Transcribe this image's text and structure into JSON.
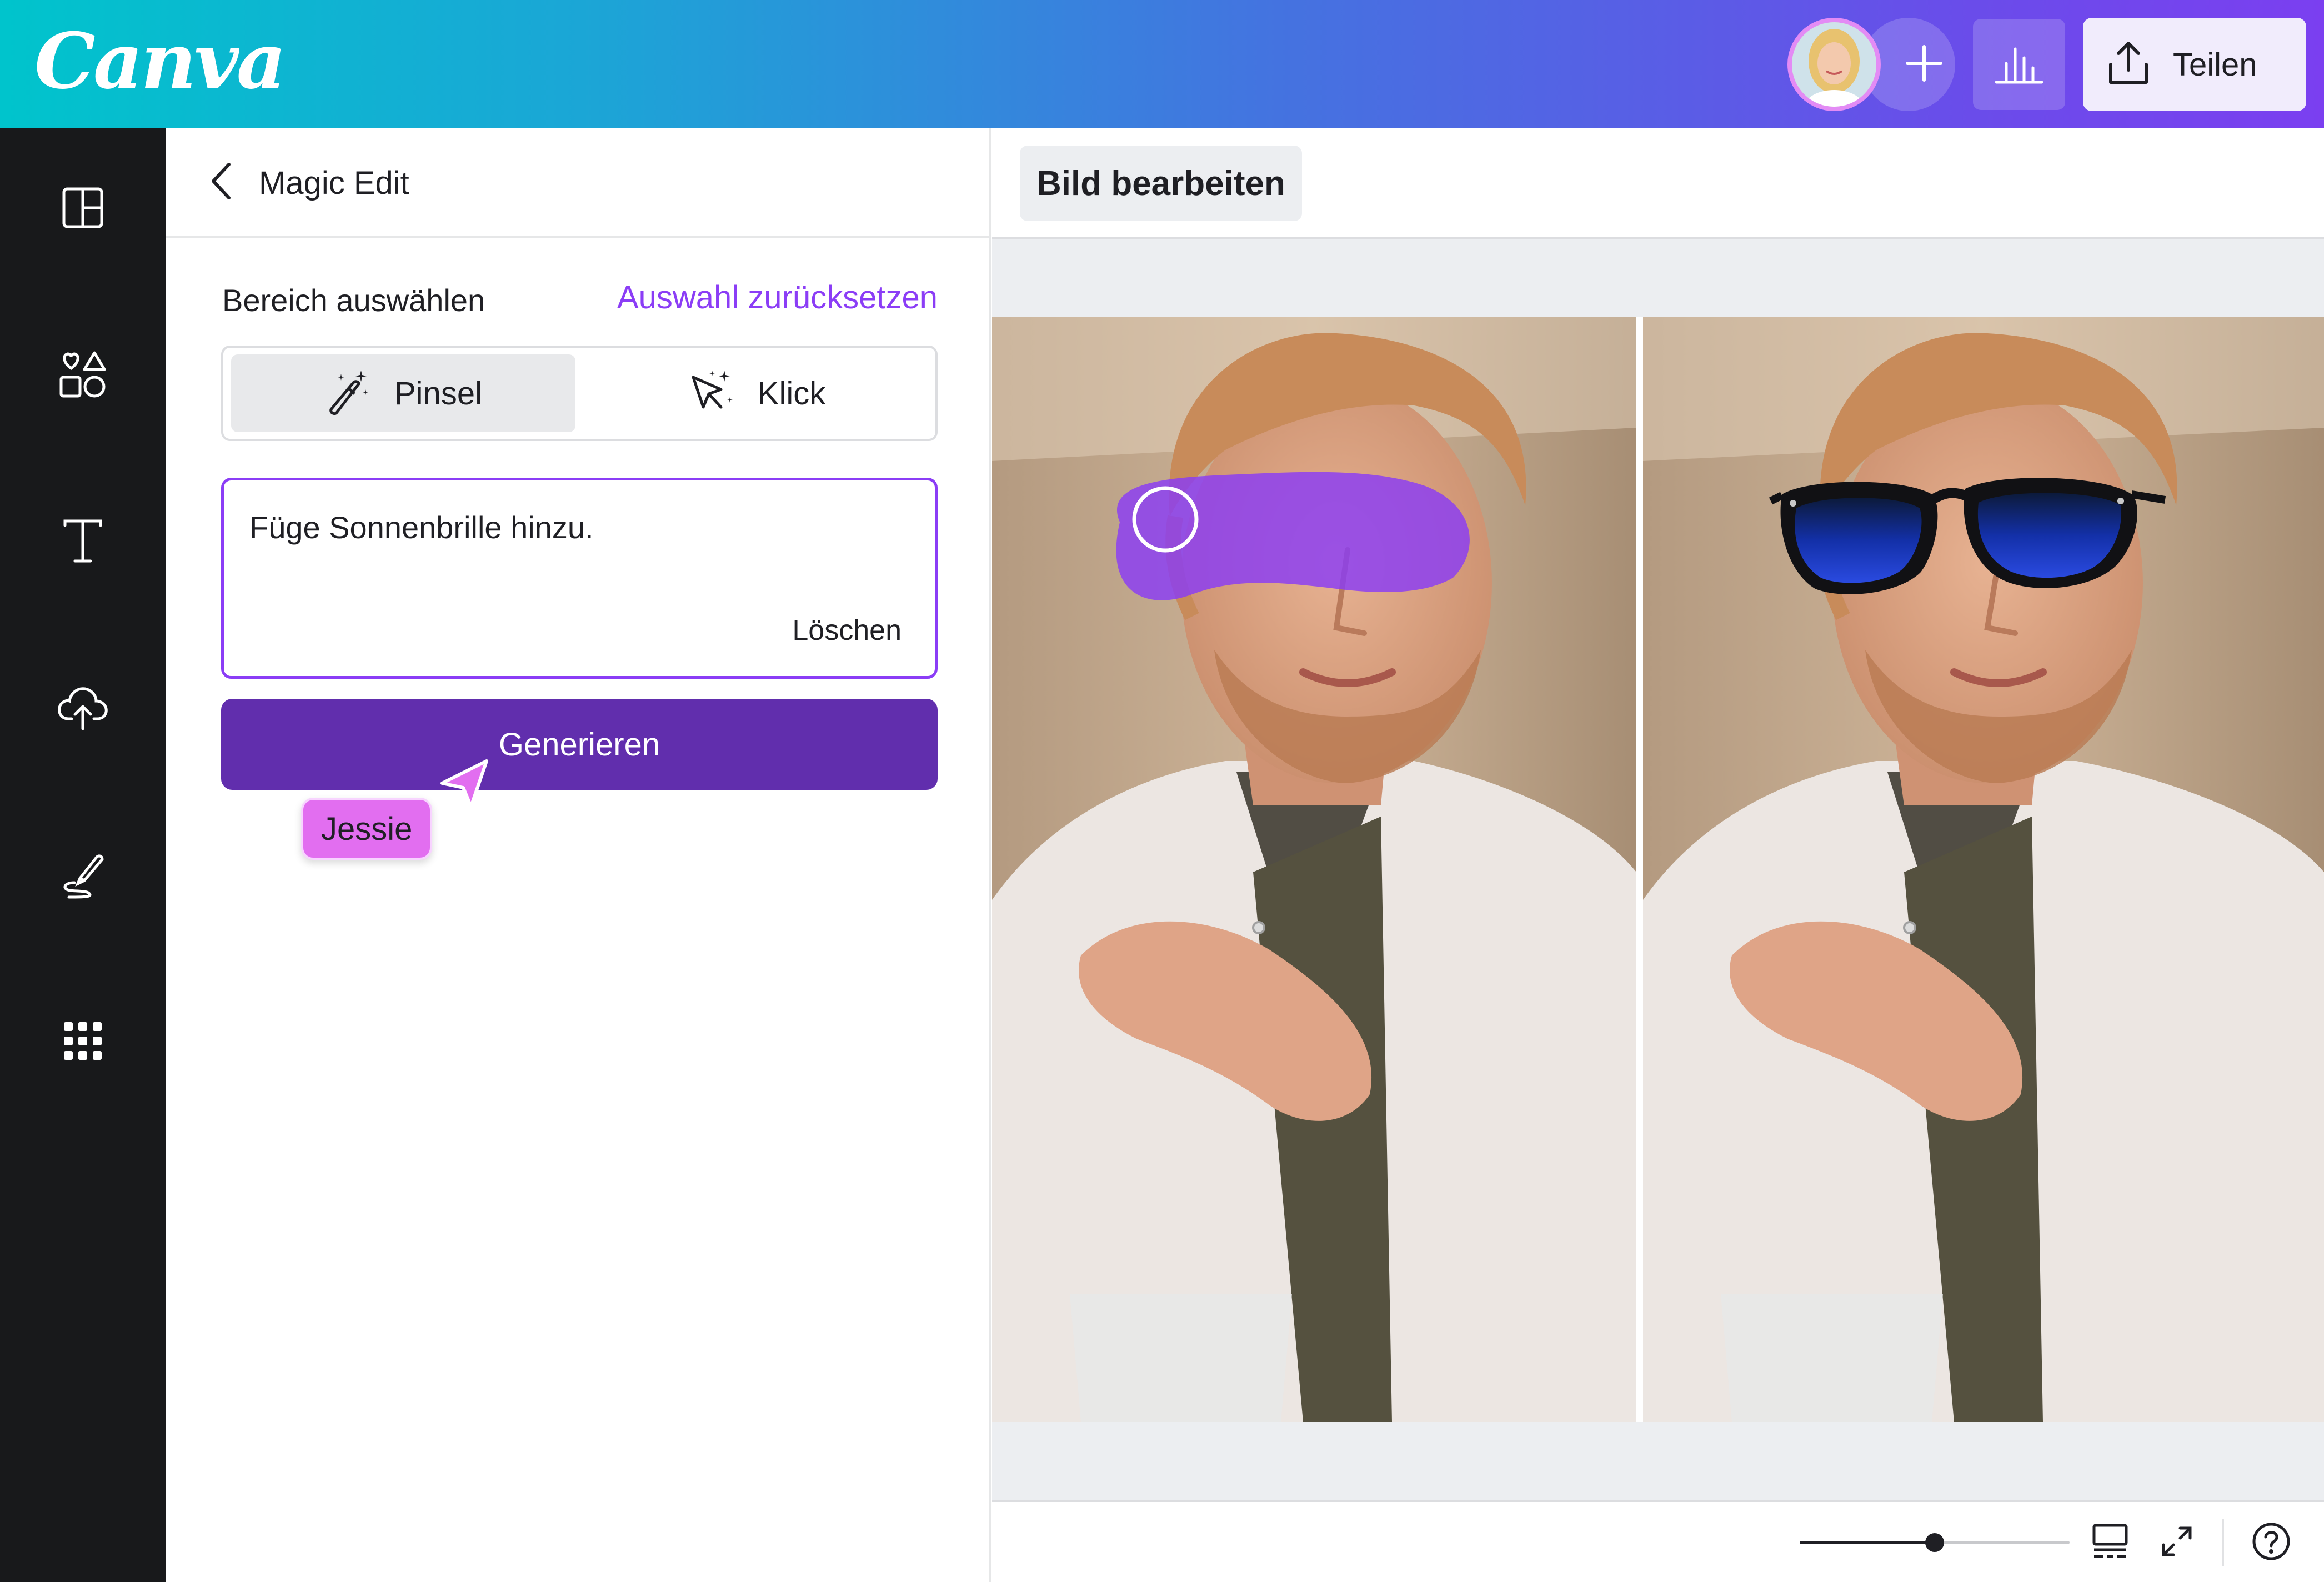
{
  "brand": {
    "logo_text": "Canva"
  },
  "topbar": {
    "share_label": "Teilen",
    "icons": {
      "add": "plus-icon",
      "insights": "bar-chart-icon",
      "share": "upload-icon"
    }
  },
  "rail": {
    "items": [
      {
        "name": "templates",
        "icon": "layout-icon"
      },
      {
        "name": "elements",
        "icon": "shapes-icon"
      },
      {
        "name": "text",
        "icon": "text-icon"
      },
      {
        "name": "uploads",
        "icon": "cloud-upload-icon"
      },
      {
        "name": "draw",
        "icon": "draw-icon"
      },
      {
        "name": "apps",
        "icon": "apps-grid-icon"
      }
    ]
  },
  "panel": {
    "title": "Magic Edit",
    "select_area_label": "Bereich auswählen",
    "reset_link": "Auswahl zurücksetzen",
    "modes": [
      {
        "label": "Pinsel",
        "icon": "magic-brush-icon",
        "selected": true
      },
      {
        "label": "Klick",
        "icon": "magic-click-icon",
        "selected": false
      }
    ],
    "prompt_text": "Füge Sonnenbrille hinzu.",
    "clear_label": "Löschen",
    "generate_label": "Generieren",
    "collaborator_name": "Jessie"
  },
  "editor": {
    "toolbar_button": "Bild bearbeiten",
    "zoom_fraction": 0.5,
    "footer_icons": [
      "page-layout-icon",
      "fullscreen-icon",
      "help-icon"
    ]
  },
  "colors": {
    "accent_purple": "#8b3df6",
    "generate_purple": "#612ead",
    "brush_overlay": "#8a3cf5",
    "rail_bg": "#18191b",
    "collaborator_tag": "#e26ef0"
  }
}
